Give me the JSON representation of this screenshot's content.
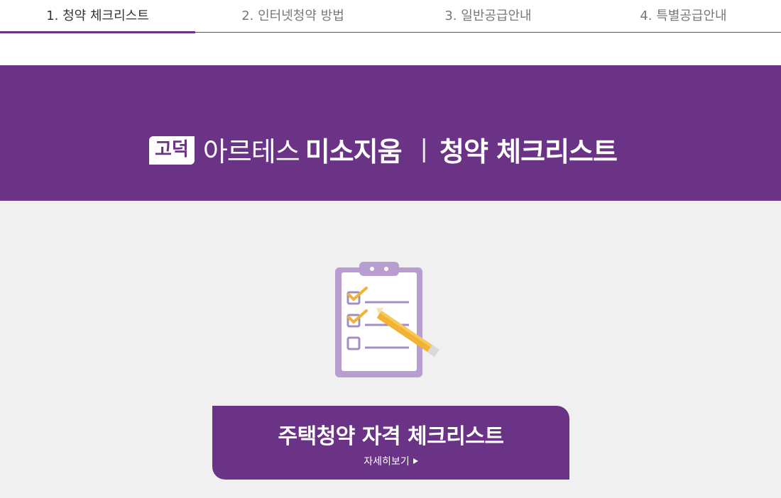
{
  "tabs": [
    {
      "label": "1. 청약 체크리스트",
      "active": true
    },
    {
      "label": "2. 인터넷청약 방법",
      "active": false
    },
    {
      "label": "3. 일반공급안내",
      "active": false
    },
    {
      "label": "4. 특별공급안내",
      "active": false
    }
  ],
  "banner": {
    "logo_badge": "고덕",
    "brand": "아르테스",
    "brand_strong": "미소지움",
    "separator": "|",
    "title": "청약 체크리스트"
  },
  "cta": {
    "title": "주택청약 자격 체크리스트",
    "more_label": "자세히보기"
  },
  "icons": {
    "clipboard": "clipboard-checklist-icon",
    "arrow": "play-arrow-icon"
  },
  "colors": {
    "brand": "#6a3386",
    "section_bg": "#f0f0f0",
    "clipboard": "#b89ed0",
    "pencil": "#f2b233"
  }
}
